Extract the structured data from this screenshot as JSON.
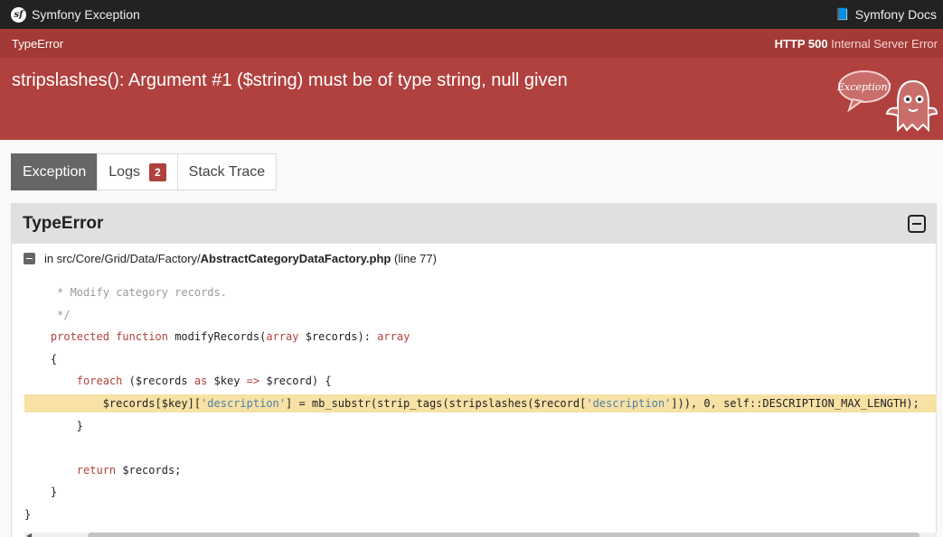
{
  "topbar": {
    "title": "Symfony Exception",
    "logo_text": "sf",
    "docs_label": "Symfony Docs",
    "docs_icon": "book-icon"
  },
  "header": {
    "exception_class": "TypeError",
    "status_code": "HTTP 500",
    "status_text": "Internal Server Error",
    "message": "stripslashes(): Argument #1 ($string) must be of type string, null given",
    "illustration_text": "Exception!"
  },
  "tabs": [
    {
      "label": "Exception",
      "active": true
    },
    {
      "label": "Logs",
      "badge": "2"
    },
    {
      "label": "Stack Trace"
    }
  ],
  "trace": {
    "title": "TypeError",
    "file_prefix": "in src/Core/Grid/Data/Factory/",
    "file_name": "AbstractCategoryDataFactory.php",
    "line_info": "(line 77)",
    "code_lines": [
      "     * Modify category records.",
      "     */",
      "    protected function modifyRecords(array $records): array",
      "    {",
      "        foreach ($records as $key => $record) {",
      "            $records[$key]['description'] = mb_substr(strip_tags(stripslashes($record['description'])), 0, self::DESCRIPTION_MAX_LENGTH);",
      "        }",
      "",
      "        return $records;",
      "    }",
      "}"
    ]
  },
  "colors": {
    "header_red": "#b0413e",
    "highlight": "#f7e1a4",
    "keyword": "#b0413e",
    "string": "#4e7fa6"
  }
}
